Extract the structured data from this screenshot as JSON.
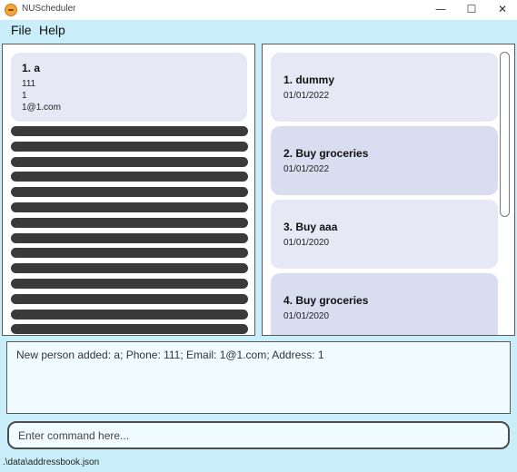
{
  "window": {
    "title": "NUScheduler",
    "minimize": "—",
    "maximize": "☐",
    "close": "✕"
  },
  "menu": {
    "file": "File",
    "help": "Help"
  },
  "person": {
    "title": "1.  a",
    "phone": "111",
    "address": "1",
    "email": "1@1.com"
  },
  "events": [
    {
      "title": "1.  dummy",
      "date": "01/01/2022"
    },
    {
      "title": "2.  Buy groceries",
      "date": "01/01/2022"
    },
    {
      "title": "3.  Buy aaa",
      "date": "01/01/2020"
    },
    {
      "title": "4.  Buy groceries",
      "date": "01/01/2020"
    }
  ],
  "result": {
    "text": "New person added: a; Phone: 111; Email: 1@1.com; Address: 1"
  },
  "command": {
    "placeholder": "Enter command here..."
  },
  "status": {
    "path": ".\\data\\addressbook.json"
  },
  "icons": {
    "app": "app-logo-icon"
  },
  "colors": {
    "accent_bg": "#c9eef9",
    "card": "#e6e8f6",
    "card_alt": "#d9ddf0",
    "stripe": "#3a3a3a"
  }
}
